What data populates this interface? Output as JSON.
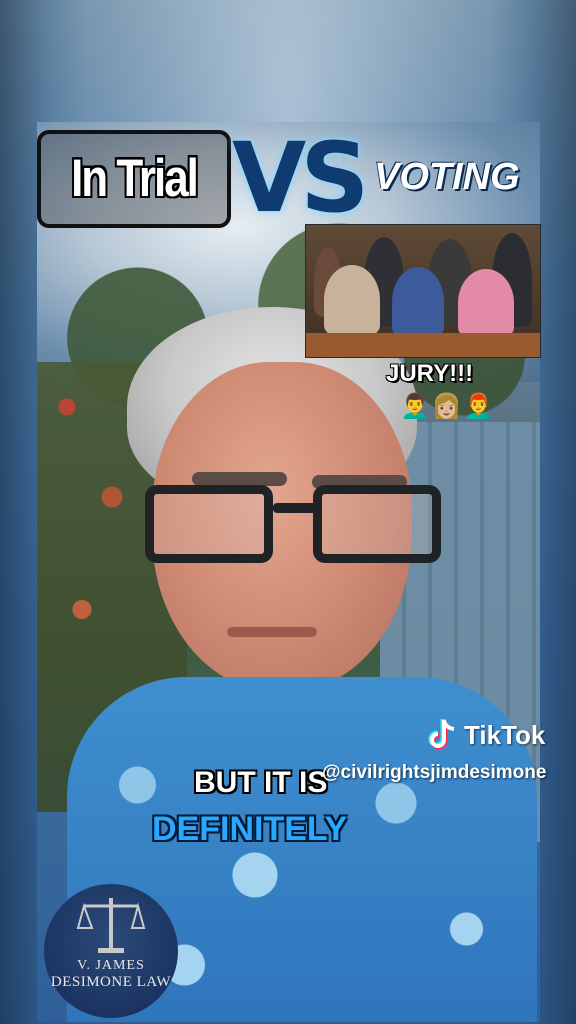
{
  "overlay": {
    "left_title": "In Trial",
    "vs": "VS",
    "right_title": "VOTING",
    "jury_caption": "JURY!!!",
    "jury_emoji": "👨‍🦱👩🏼👨‍🦰"
  },
  "captions": {
    "line1": "BUT IT IS",
    "line2": "DEFINITELY"
  },
  "watermark": {
    "brand": "TikTok",
    "handle": "@civilrightsjimdesimone"
  },
  "logo": {
    "line1": "V. JAMES",
    "line2": "DESIMONE LAW"
  },
  "colors": {
    "accent_blue": "#2aa8ff",
    "vs_blue": "#0f3b70",
    "logo_bg": "#1c3461"
  }
}
